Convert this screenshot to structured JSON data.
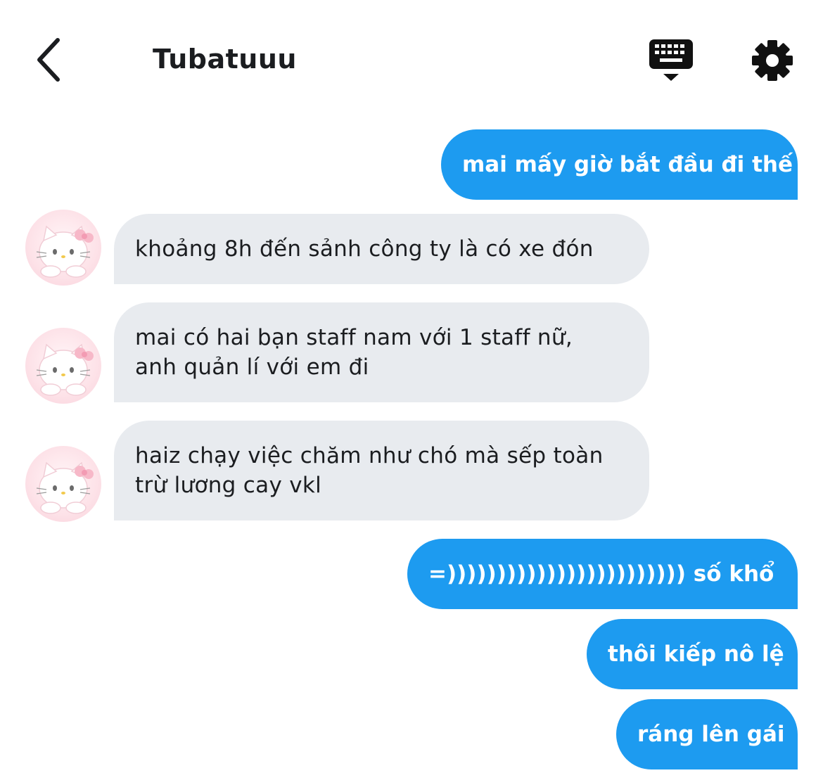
{
  "header": {
    "title": "Tubatuuu",
    "icons": {
      "back": "chevron-left-icon",
      "keyboard": "keyboard-icon",
      "settings": "gear-icon"
    }
  },
  "colors": {
    "outgoing_bubble": "#1d9bf0",
    "incoming_bubble": "#e8ebef",
    "text": "#1b1d20"
  },
  "messages": [
    {
      "direction": "outgoing",
      "text": "mai mấy giờ bắt đầu đi thế"
    },
    {
      "direction": "incoming",
      "text": "khoảng 8h đến sảnh công ty là có xe đón",
      "avatar": "hello-kitty-avatar"
    },
    {
      "direction": "incoming",
      "lines": [
        "mai có hai bạn staff nam với 1 staff nữ,",
        "anh quản lí với em đi"
      ],
      "avatar": "hello-kitty-avatar"
    },
    {
      "direction": "incoming",
      "lines": [
        "haiz chạy việc chăm như chó mà sếp toàn",
        "trừ lương cay vkl"
      ],
      "avatar": "hello-kitty-avatar"
    },
    {
      "direction": "outgoing",
      "text": "=)))))))))))))))))))))))) số khổ"
    },
    {
      "direction": "outgoing",
      "text": "thôi kiếp nô lệ"
    },
    {
      "direction": "outgoing",
      "text": "ráng lên gái"
    }
  ]
}
